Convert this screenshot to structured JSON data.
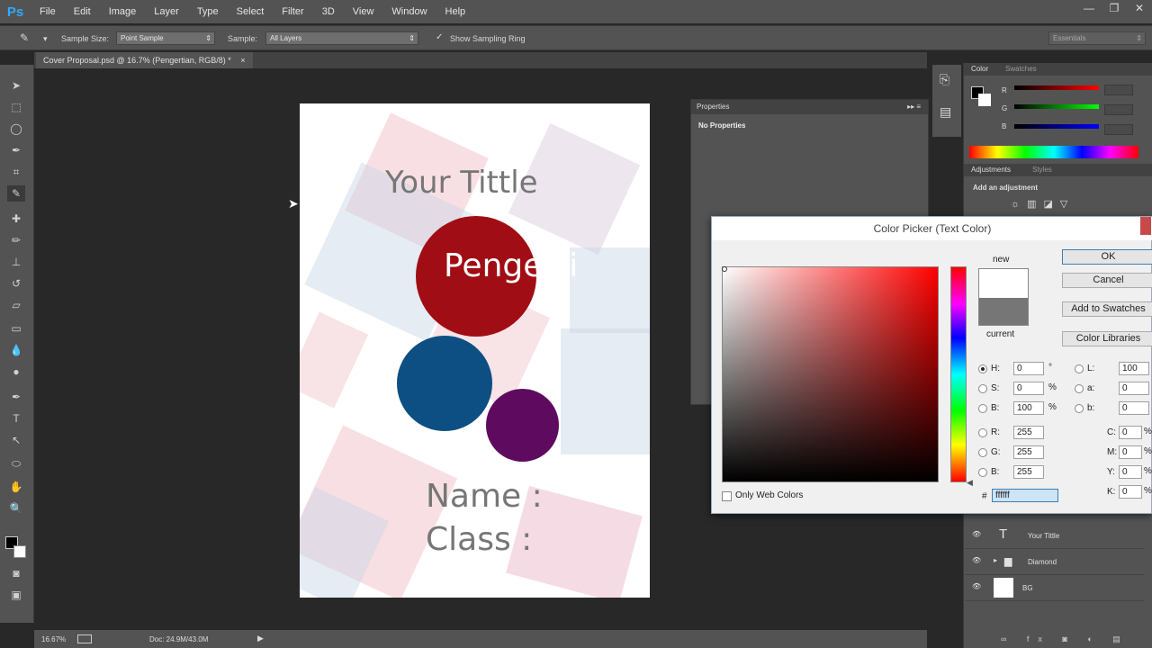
{
  "app": {
    "logo": "Ps"
  },
  "menu": [
    "File",
    "Edit",
    "Image",
    "Layer",
    "Type",
    "Select",
    "Filter",
    "3D",
    "View",
    "Window",
    "Help"
  ],
  "window_controls": [
    "minimize-icon",
    "restore-icon",
    "close-icon"
  ],
  "options_bar": {
    "sample_size_label": "Sample Size:",
    "sample_size_value": "Point Sample",
    "sample_label": "Sample:",
    "sample_value": "All Layers",
    "show_ring_label": "Show Sampling Ring",
    "workspace": "Essentials"
  },
  "document_tab": {
    "title": "Cover Proposal.psd @ 16.7% (Pengertian, RGB/8) *",
    "close": "×"
  },
  "document": {
    "title_text": "Your Tittle",
    "circle_text": "Pengerti",
    "name_label": "Name :",
    "class_label": "Class :",
    "colors": {
      "red": "#a10d14",
      "blue": "#0d4f82",
      "purple": "#5e0b5f"
    }
  },
  "status_bar": {
    "zoom": "16.67%",
    "doc": "Doc: 24.9M/43.0M"
  },
  "properties_panel": {
    "title": "Properties",
    "empty": "No Properties"
  },
  "color_panel": {
    "tabs": [
      "Color",
      "Swatches"
    ],
    "channels": [
      "R",
      "G",
      "B"
    ]
  },
  "adjustments_panel": {
    "tabs": [
      "Adjustments",
      "Styles"
    ],
    "subtitle": "Add an adjustment"
  },
  "layers": [
    {
      "name": "Your Tittle",
      "kind": "text"
    },
    {
      "name": "Diamond",
      "kind": "group"
    },
    {
      "name": "BG",
      "kind": "pixel"
    }
  ],
  "color_picker": {
    "title": "Color Picker (Text Color)",
    "buttons": {
      "ok": "OK",
      "cancel": "Cancel",
      "add_swatches": "Add to Swatches",
      "libraries": "Color Libraries"
    },
    "new_label": "new",
    "current_label": "current",
    "new_color": "#ffffff",
    "current_color": "#767676",
    "only_web": "Only Web Colors",
    "hsb": {
      "H": "0",
      "S": "0",
      "B": "100",
      "H_unit": "°",
      "S_unit": "%",
      "B_unit": "%"
    },
    "rgb": {
      "R": "255",
      "G": "255",
      "B": "255"
    },
    "lab": {
      "L": "100",
      "a": "0",
      "b": "0"
    },
    "cmyk": {
      "C": "0",
      "M": "0",
      "Y": "0",
      "K": "0",
      "unit": "%"
    },
    "hex": "ffffff",
    "hex_label": "#"
  }
}
